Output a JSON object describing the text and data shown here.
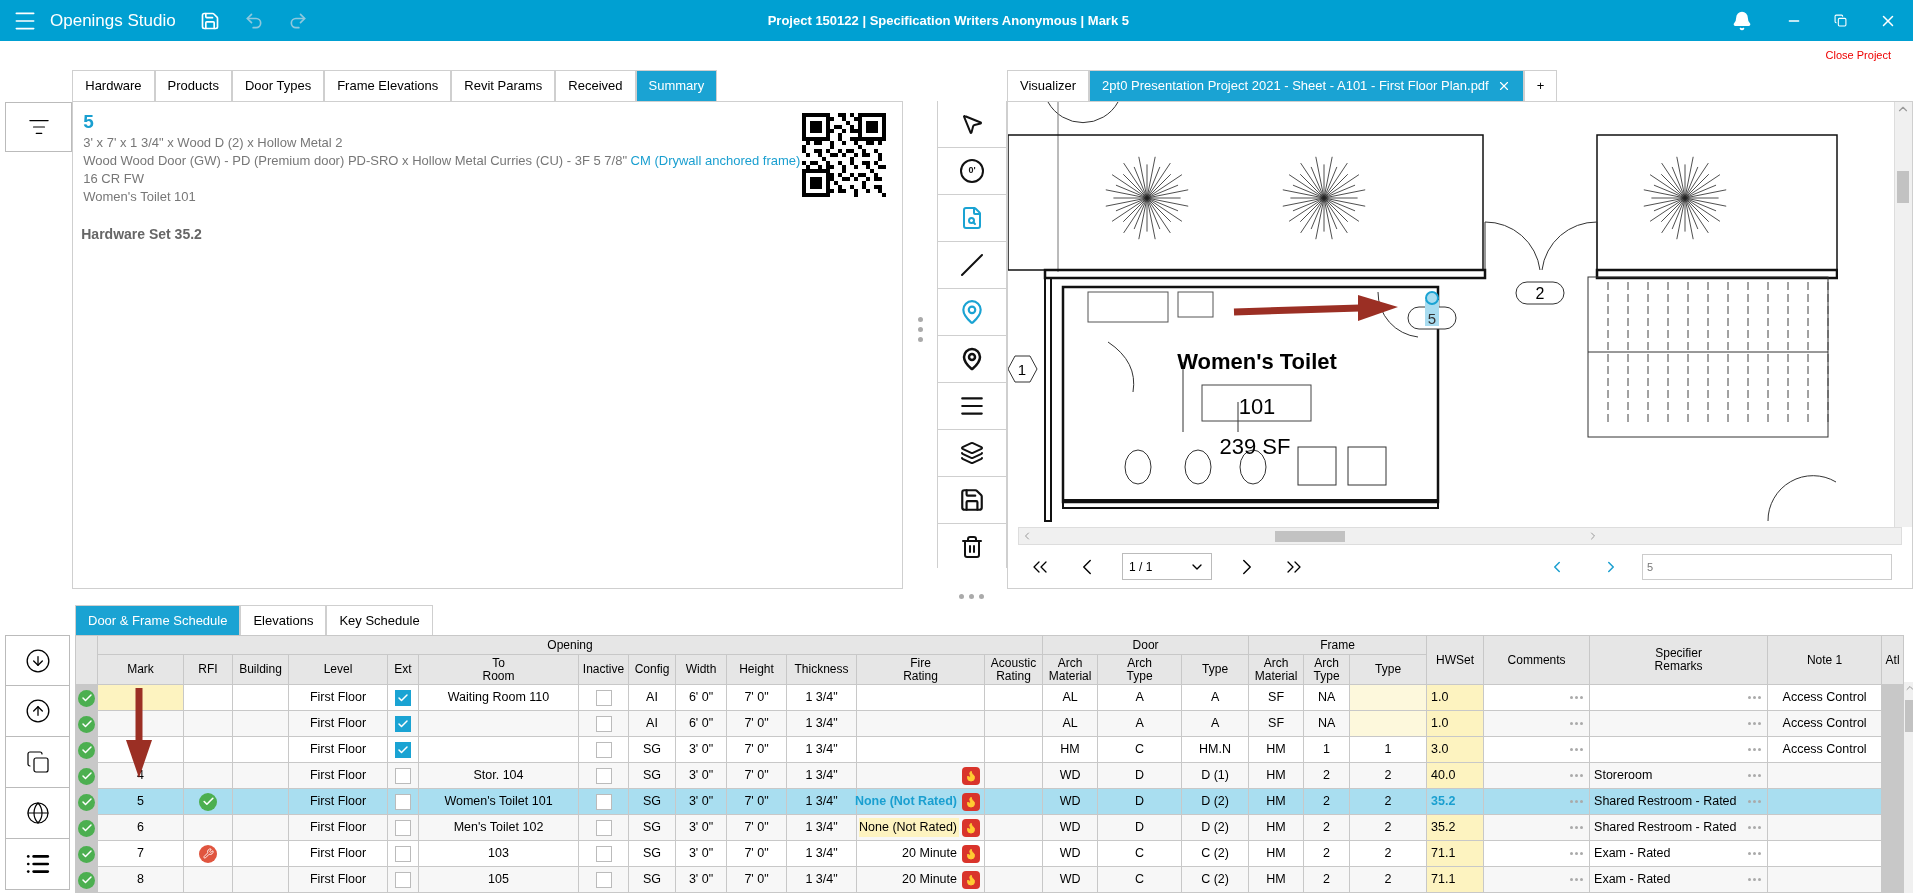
{
  "app": {
    "title": "Openings Studio",
    "project_title": "Project 150122 | Specification Writers Anonymous | Mark 5",
    "undo_disabled": true,
    "redo_disabled": true
  },
  "close_project": "Close Project",
  "detail_tabs": [
    {
      "label": "Hardware",
      "selected": false
    },
    {
      "label": "Products",
      "selected": false
    },
    {
      "label": "Door Types",
      "selected": false
    },
    {
      "label": "Frame Elevations",
      "selected": false
    },
    {
      "label": "Revit Params",
      "selected": false
    },
    {
      "label": "Received",
      "selected": false
    },
    {
      "label": "Summary",
      "selected": true
    }
  ],
  "summary": {
    "mark": "5",
    "lines": [
      [
        {
          "text": "3' x 7' x 1 3/4\" x Wood D (2) x Hollow Metal 2",
          "link": false
        }
      ],
      [
        {
          "text": "Wood Wood Door (GW) - PD (Premium door) PD-SRO x Hollow Metal Curries (CU) - 3F 5 7/8\" ",
          "link": false
        },
        {
          "text": "CM (Drywall anchored frame)",
          "link": true
        },
        {
          "text": " 16 CR FW",
          "link": false
        }
      ],
      [
        {
          "text": "Women's Toilet 101",
          "link": false
        }
      ]
    ],
    "hardware_set": "Hardware Set 35.2"
  },
  "visualizer": {
    "tabs": [
      {
        "label": "Visualizer",
        "selected": false,
        "closable": false
      },
      {
        "label": "2pt0 Presentation Project 2021 - Sheet - A101 - First Floor Plan.pdf",
        "selected": true,
        "closable": true
      },
      {
        "label": "+",
        "selected": false,
        "closable": false
      }
    ],
    "tools": [
      {
        "kind": "pointer",
        "selected": false
      },
      {
        "kind": "rotate",
        "label": "0'",
        "selected": false
      },
      {
        "kind": "doc-search",
        "selected": true
      },
      {
        "kind": "line",
        "selected": false
      },
      {
        "kind": "pin",
        "selected": true
      },
      {
        "kind": "pin-filter",
        "selected": false
      },
      {
        "kind": "lines",
        "selected": false
      },
      {
        "kind": "layers",
        "selected": false
      },
      {
        "kind": "save",
        "selected": false
      },
      {
        "kind": "trash",
        "selected": false
      }
    ],
    "plan": {
      "room_name": "Women's Toilet",
      "room_number": "101",
      "room_area": "239 SF",
      "tags": [
        "1",
        "2"
      ],
      "pin_mark": "5"
    },
    "page": "1 / 1",
    "search": "5"
  },
  "schedule": {
    "tabs": [
      {
        "label": "Door & Frame Schedule",
        "selected": true
      },
      {
        "label": "Elevations",
        "selected": false
      },
      {
        "label": "Key Schedule",
        "selected": false
      }
    ],
    "groups": [
      "Opening",
      "Door",
      "Frame"
    ],
    "columns": [
      "Mark",
      "RFI",
      "Building",
      "Level",
      "Ext",
      "To\nRoom",
      "Inactive",
      "Config",
      "Width",
      "Height",
      "Thickness",
      "Fire\nRating",
      "Acoustic\nRating",
      "Arch\nMaterial",
      "Arch\nType",
      "Type",
      "Arch\nMaterial",
      "Arch\nType",
      "Type",
      "HWSet",
      "Comments",
      "Specifier\nRemarks",
      "Note 1",
      "Atl"
    ],
    "rows": [
      {
        "valid": true,
        "selected": false,
        "mark_highlighted": true,
        "frame_type_highlighted": true,
        "fire_rating_highlighted": false,
        "rfi_approved": false,
        "rfi_open": false,
        "level": "First Floor",
        "ext": true,
        "inactive": false,
        "to_room": "Waiting Room 110",
        "config": "AI",
        "width": "6' 0\"",
        "height": "7' 0\"",
        "thickness": "1 3/4\"",
        "fire_icon": false,
        "door_material": "AL",
        "door_arch_type": "A",
        "door_type": "A",
        "frame_material": "SF",
        "frame_arch_type": "NA",
        "hwset": "1.0",
        "note_1": "Access Control"
      },
      {
        "valid": true,
        "selected": false,
        "mark_highlighted": false,
        "frame_type_highlighted": true,
        "fire_rating_highlighted": false,
        "rfi_approved": false,
        "rfi_open": false,
        "level": "First Floor",
        "ext": true,
        "inactive": false,
        "config": "AI",
        "width": "6' 0\"",
        "height": "7' 0\"",
        "thickness": "1 3/4\"",
        "fire_icon": false,
        "door_material": "AL",
        "door_arch_type": "A",
        "door_type": "A",
        "frame_material": "SF",
        "frame_arch_type": "NA",
        "hwset": "1.0",
        "note_1": "Access Control"
      },
      {
        "valid": true,
        "selected": false,
        "mark_highlighted": false,
        "frame_type_highlighted": false,
        "fire_rating_highlighted": false,
        "rfi_approved": false,
        "rfi_open": false,
        "level": "First Floor",
        "ext": true,
        "inactive": false,
        "config": "SG",
        "width": "3' 0\"",
        "height": "7' 0\"",
        "thickness": "1 3/4\"",
        "fire_icon": false,
        "door_material": "HM",
        "door_arch_type": "C",
        "door_type": "HM.N",
        "frame_material": "HM",
        "frame_arch_type": "1",
        "frame_type": "1",
        "hwset": "3.0",
        "note_1": "Access Control"
      },
      {
        "valid": true,
        "selected": false,
        "mark_highlighted": false,
        "frame_type_highlighted": false,
        "fire_rating_highlighted": false,
        "rfi_approved": false,
        "rfi_open": false,
        "mark": "4",
        "level": "First Floor",
        "ext": false,
        "inactive": false,
        "to_room": "Stor. 104",
        "config": "SG",
        "width": "3' 0\"",
        "height": "7' 0\"",
        "thickness": "1 3/4\"",
        "fire_icon": true,
        "door_material": "WD",
        "door_arch_type": "D",
        "door_type": "D (1)",
        "frame_material": "HM",
        "frame_arch_type": "2",
        "frame_type": "2",
        "hwset": "40.0",
        "specifier_remarks": "Storeroom"
      },
      {
        "valid": true,
        "selected": true,
        "mark_highlighted": false,
        "frame_type_highlighted": false,
        "fire_rating_highlighted": false,
        "rfi_approved": true,
        "rfi_open": false,
        "mark": "5",
        "level": "First Floor",
        "ext": false,
        "inactive": false,
        "to_room": "Women's Toilet 101",
        "config": "SG",
        "width": "3' 0\"",
        "height": "7' 0\"",
        "thickness": "1 3/4\"",
        "fire_rating": "None (Not Rated)",
        "fire_icon": true,
        "door_material": "WD",
        "door_arch_type": "D",
        "door_type": "D (2)",
        "frame_material": "HM",
        "frame_arch_type": "2",
        "frame_type": "2",
        "hwset": "35.2",
        "specifier_remarks": "Shared Restroom - Rated"
      },
      {
        "valid": true,
        "selected": false,
        "mark_highlighted": false,
        "frame_type_highlighted": false,
        "fire_rating_highlighted": true,
        "rfi_approved": false,
        "rfi_open": false,
        "mark": "6",
        "level": "First Floor",
        "ext": false,
        "inactive": false,
        "to_room": "Men's Toilet 102",
        "config": "SG",
        "width": "3' 0\"",
        "height": "7' 0\"",
        "thickness": "1 3/4\"",
        "fire_rating": "None (Not Rated)",
        "fire_icon": true,
        "door_material": "WD",
        "door_arch_type": "D",
        "door_type": "D (2)",
        "frame_material": "HM",
        "frame_arch_type": "2",
        "frame_type": "2",
        "hwset": "35.2",
        "specifier_remarks": "Shared Restroom - Rated"
      },
      {
        "valid": true,
        "selected": false,
        "mark_highlighted": false,
        "frame_type_highlighted": false,
        "fire_rating_highlighted": false,
        "rfi_approved": false,
        "rfi_open": true,
        "mark": "7",
        "level": "First Floor",
        "ext": false,
        "inactive": false,
        "to_room": "103",
        "config": "SG",
        "width": "3' 0\"",
        "height": "7' 0\"",
        "thickness": "1 3/4\"",
        "fire_rating": "20 Minute",
        "fire_icon": true,
        "door_material": "WD",
        "door_arch_type": "C",
        "door_type": "C (2)",
        "frame_material": "HM",
        "frame_arch_type": "2",
        "frame_type": "2",
        "hwset": "71.1",
        "specifier_remarks": "Exam - Rated"
      },
      {
        "valid": true,
        "selected": false,
        "mark_highlighted": false,
        "frame_type_highlighted": false,
        "fire_rating_highlighted": false,
        "rfi_approved": false,
        "rfi_open": false,
        "mark": "8",
        "level": "First Floor",
        "ext": false,
        "inactive": false,
        "to_room": "105",
        "config": "SG",
        "width": "3' 0\"",
        "height": "7' 0\"",
        "thickness": "1 3/4\"",
        "fire_rating": "20 Minute",
        "fire_icon": true,
        "door_material": "WD",
        "door_arch_type": "C",
        "door_type": "C (2)",
        "frame_material": "HM",
        "frame_arch_type": "2",
        "frame_type": "2",
        "hwset": "71.1",
        "specifier_remarks": "Exam - Rated"
      }
    ]
  }
}
